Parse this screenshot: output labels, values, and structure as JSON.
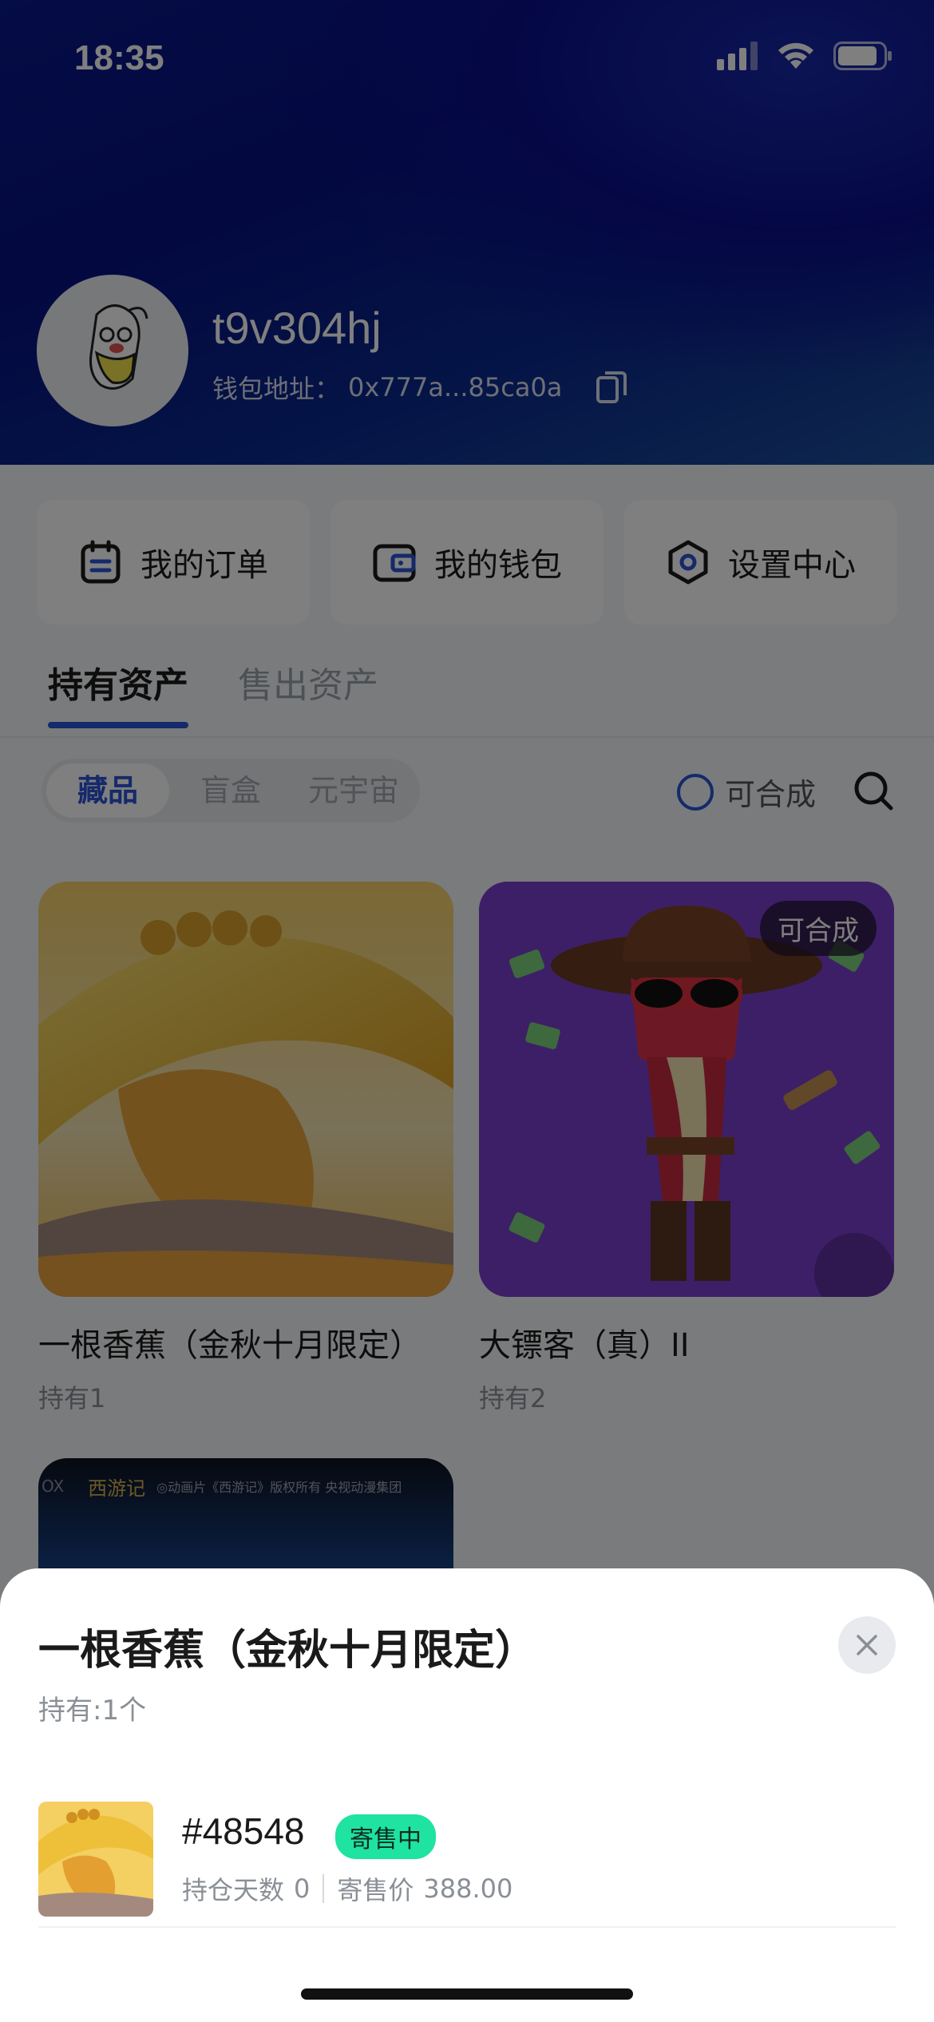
{
  "status_bar": {
    "time": "18:35"
  },
  "profile": {
    "username": "t9v304hj",
    "wallet_label": "钱包地址：",
    "wallet_address": "0x777a...85ca0a"
  },
  "quick_actions": [
    {
      "label": "我的订单",
      "icon": "order-icon"
    },
    {
      "label": "我的钱包",
      "icon": "wallet-icon"
    },
    {
      "label": "设置中心",
      "icon": "settings-icon"
    }
  ],
  "tabs": {
    "holding": "持有资产",
    "sold": "售出资产"
  },
  "segments": [
    "藏品",
    "盲盒",
    "元宇宙"
  ],
  "filter": {
    "combinable_label": "可合成"
  },
  "assets": [
    {
      "title": "一根香蕉（金秋十月限定）",
      "holding": "持有1"
    },
    {
      "title": "大镖客（真）II",
      "holding": "持有2",
      "badge": "可合成"
    }
  ],
  "third_card": {
    "brand": "西游记",
    "caption": "◎动画片《西游记》版权所有 央视动漫集团",
    "left_text": "OX"
  },
  "sheet": {
    "title": "一根香蕉（金秋十月限定）",
    "holding": "持有:1个",
    "item": {
      "id": "#48548",
      "status": "寄售中",
      "days_label": "持仓天数",
      "days_value": "0",
      "price_label": "寄售价",
      "price_value": "388.00"
    }
  },
  "colors": {
    "accent": "#2a54d6",
    "sale_badge": "#1fe3a0"
  }
}
